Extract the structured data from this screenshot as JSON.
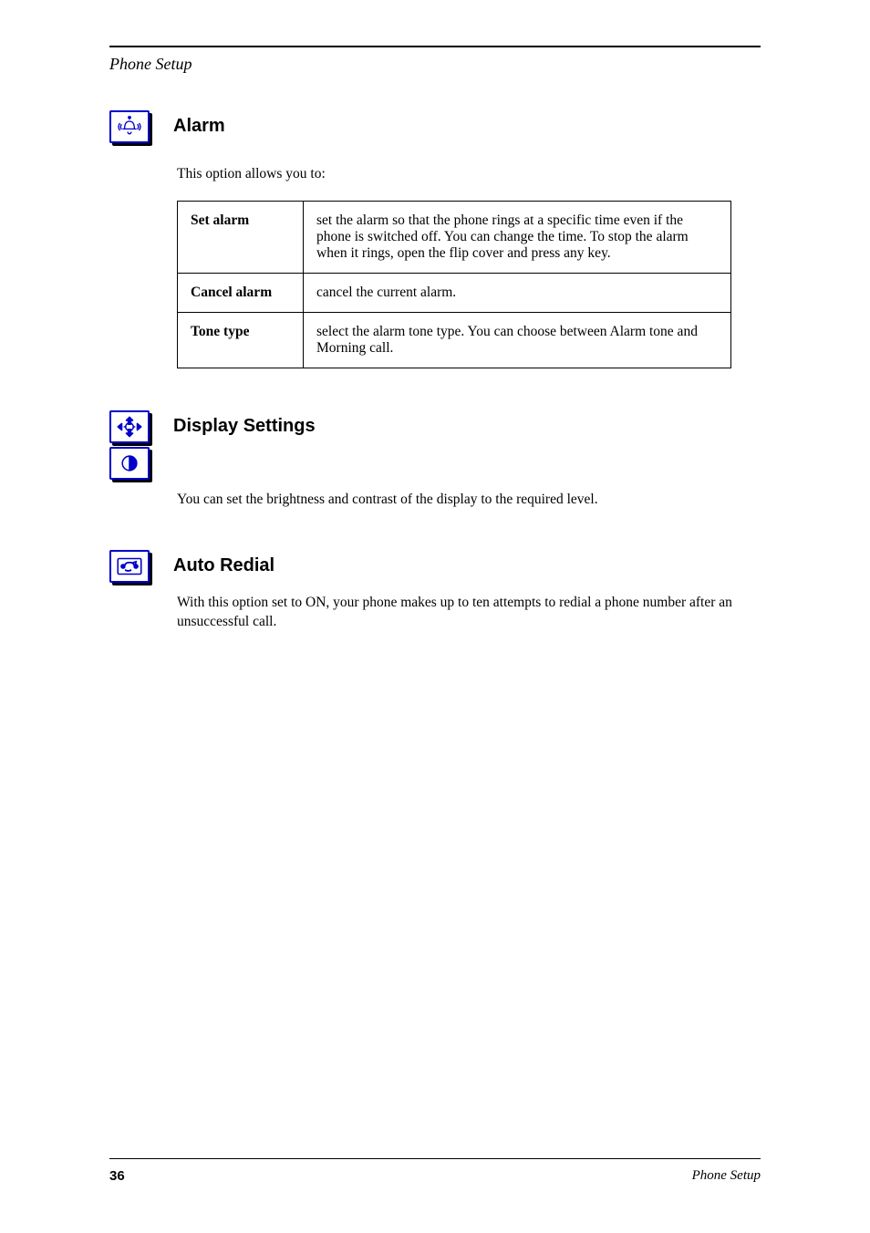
{
  "header": {
    "title": "Phone Setup"
  },
  "sections": {
    "alarm": {
      "heading": "Alarm",
      "intro": "This option allows you to:",
      "table": [
        {
          "name": "Set alarm",
          "desc": "set the alarm so that the phone rings at a specific time even if the phone is switched off. You can change the time. To stop the alarm when it rings, open the flip cover and press any key."
        },
        {
          "name": "Cancel alarm",
          "desc": "cancel the current alarm."
        },
        {
          "name": "Tone type",
          "desc": "select the alarm tone type. You can choose between Alarm tone and Morning call."
        }
      ]
    },
    "display": {
      "heading": "Display Settings",
      "body": "You can set the brightness and contrast of the display to the required level."
    },
    "autoredial": {
      "heading": "Auto Redial",
      "body": "With this option set to ON, your phone makes up to ten attempts to redial a phone number after an unsuccessful call."
    }
  },
  "footer": {
    "left": "36",
    "right": "Phone Setup"
  }
}
